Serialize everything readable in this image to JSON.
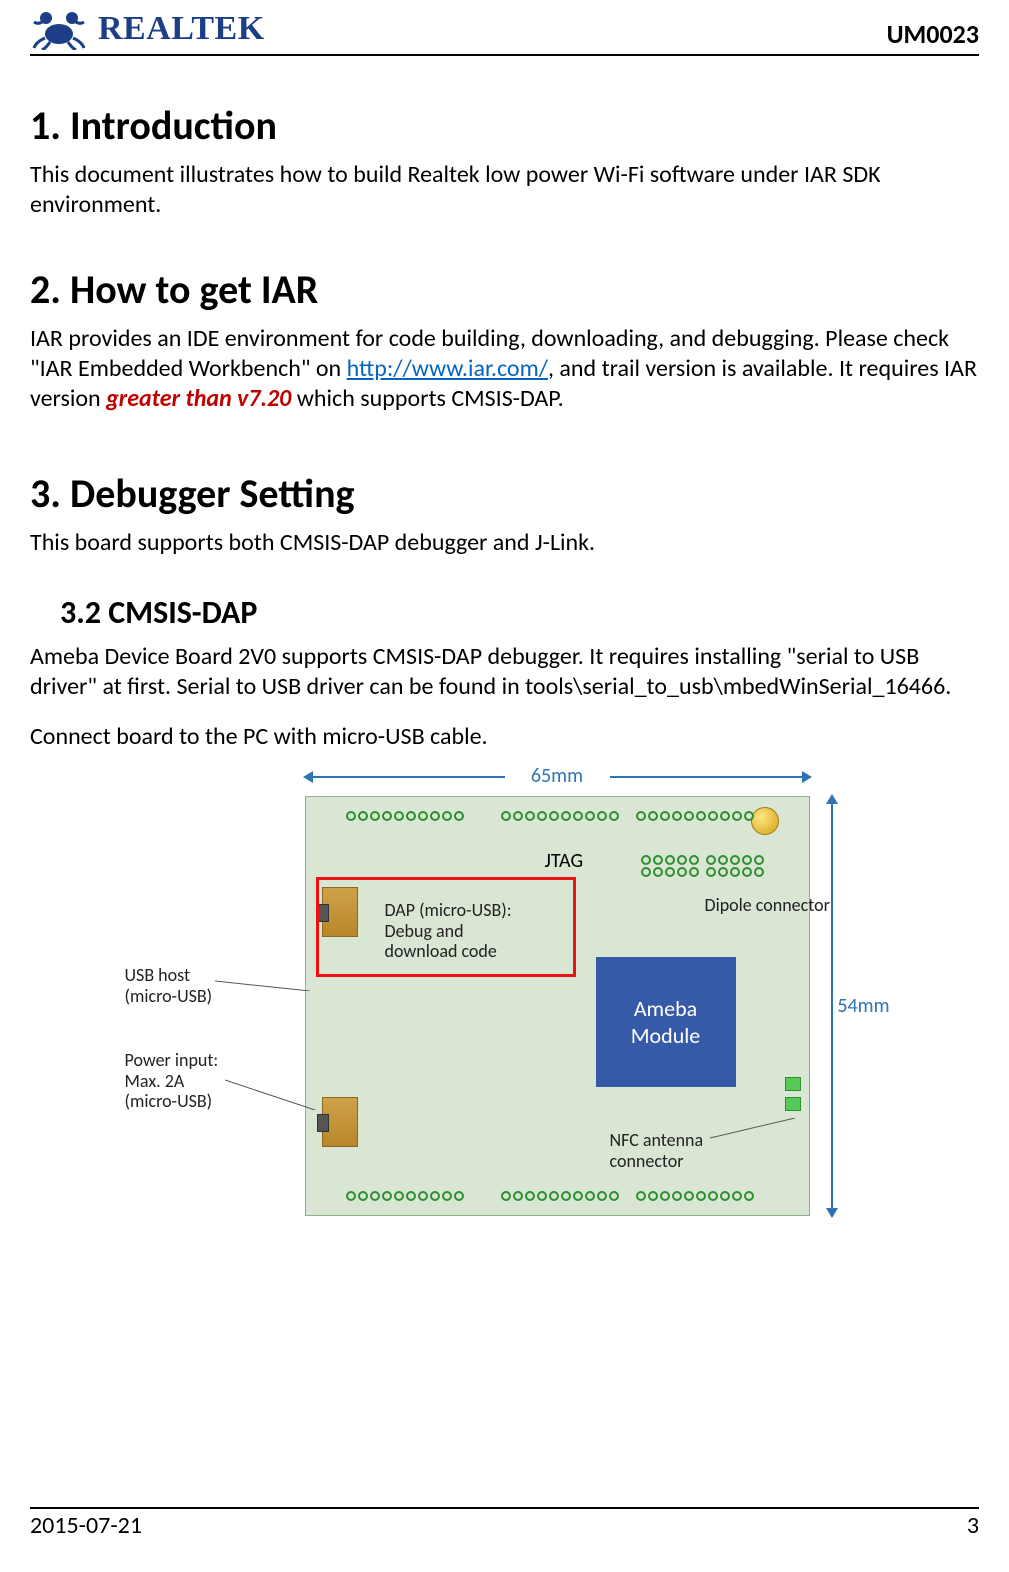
{
  "header": {
    "brand": "REALTEK",
    "doc_id": "UM0023"
  },
  "sections": {
    "s1": {
      "num": "1.",
      "title": "Introduction"
    },
    "s2": {
      "num": "2.",
      "title": "How to get IAR"
    },
    "s3": {
      "num": "3.",
      "title": "Debugger Setting"
    },
    "s3_2": {
      "num": "3.2",
      "title": "CMSIS-DAP"
    }
  },
  "body": {
    "intro": "This document illustrates how to build Realtek low power Wi-Fi software under IAR SDK environment.",
    "iar_pre": "IAR provides an IDE environment for code building, downloading, and debugging. Please check \"IAR Embedded Workbench\" on ",
    "iar_link": "http://www.iar.com/",
    "iar_mid": ", and trail version is available. It requires IAR version ",
    "iar_emph": "greater than v7.20",
    "iar_post": " which supports CMSIS-DAP.",
    "debugger_intro": "This board supports both CMSIS-DAP debugger and J-Link.",
    "cmsis_p1": "Ameba Device Board 2V0 supports CMSIS-DAP debugger. It requires installing \"serial to USB driver\" at first. Serial to USB driver can be found in tools\\serial_to_usb\\mbedWinSerial_16466.",
    "cmsis_p2": "Connect board to the PC with micro-USB cable."
  },
  "figure": {
    "dim_w": "65mm",
    "dim_h": "54mm",
    "module": "Ameba Module",
    "jtag": "JTAG",
    "dipole": "Dipole connector",
    "dap_l1": "DAP (micro-USB):",
    "dap_l2": "Debug and",
    "dap_l3": "download code",
    "usbhost_l1": "USB host",
    "usbhost_l2": "(micro-USB)",
    "power_l1": "Power input:",
    "power_l2": "Max. 2A",
    "power_l3": "(micro-USB)",
    "nfc_l1": "NFC antenna",
    "nfc_l2": "connector"
  },
  "footer": {
    "date": "2015-07-21",
    "page": "3"
  }
}
